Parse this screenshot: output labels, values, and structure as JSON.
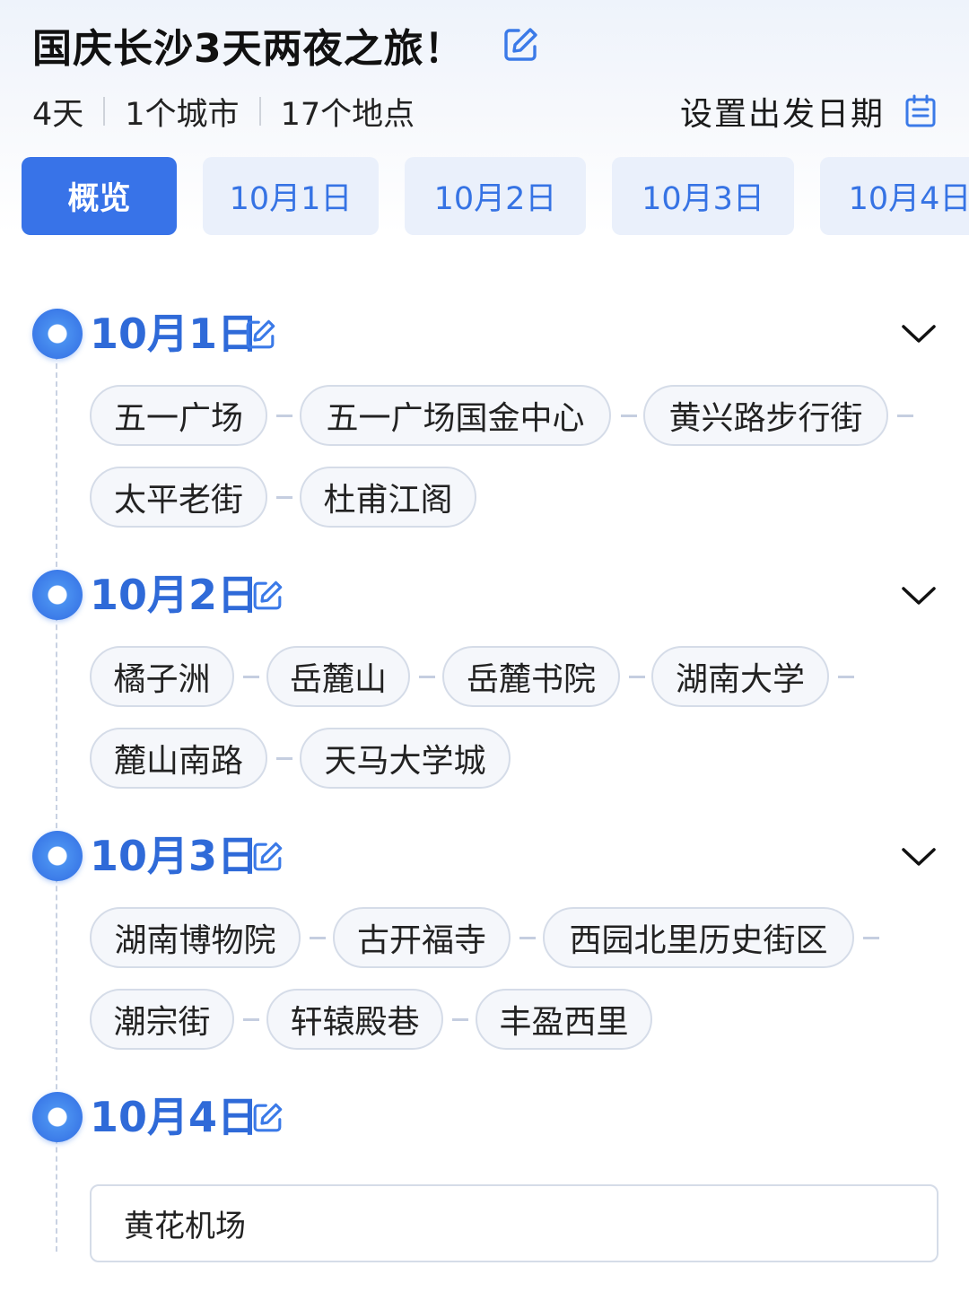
{
  "header": {
    "title": "国庆长沙3天两夜之旅！",
    "days": "4天",
    "cities": "1个城市",
    "places": "17个地点",
    "set_date_label": "设置出发日期"
  },
  "tabs": [
    "概览",
    "10月1日",
    "10月2日",
    "10月3日",
    "10月4日"
  ],
  "itinerary": [
    {
      "date": "10月1日",
      "places": [
        "五一广场",
        "五一广场国金中心",
        "黄兴路步行街",
        "太平老街",
        "杜甫江阁"
      ]
    },
    {
      "date": "10月2日",
      "places": [
        "橘子洲",
        "岳麓山",
        "岳麓书院",
        "湖南大学",
        "麓山南路",
        "天马大学城"
      ]
    },
    {
      "date": "10月3日",
      "places": [
        "湖南博物院",
        "古开福寺",
        "西园北里历史街区",
        "潮宗街",
        "轩辕殿巷",
        "丰盈西里"
      ]
    },
    {
      "date": "10月4日",
      "places": [
        "黄花机场"
      ]
    }
  ],
  "colors": {
    "accent": "#3873e8",
    "accent_text": "#2f6ad8",
    "tab_bg": "#eaf0fb",
    "chip_border": "#d5dce8"
  },
  "icons": [
    "edit-icon",
    "calendar-icon",
    "chevron-down-icon",
    "timeline-dot-icon"
  ]
}
